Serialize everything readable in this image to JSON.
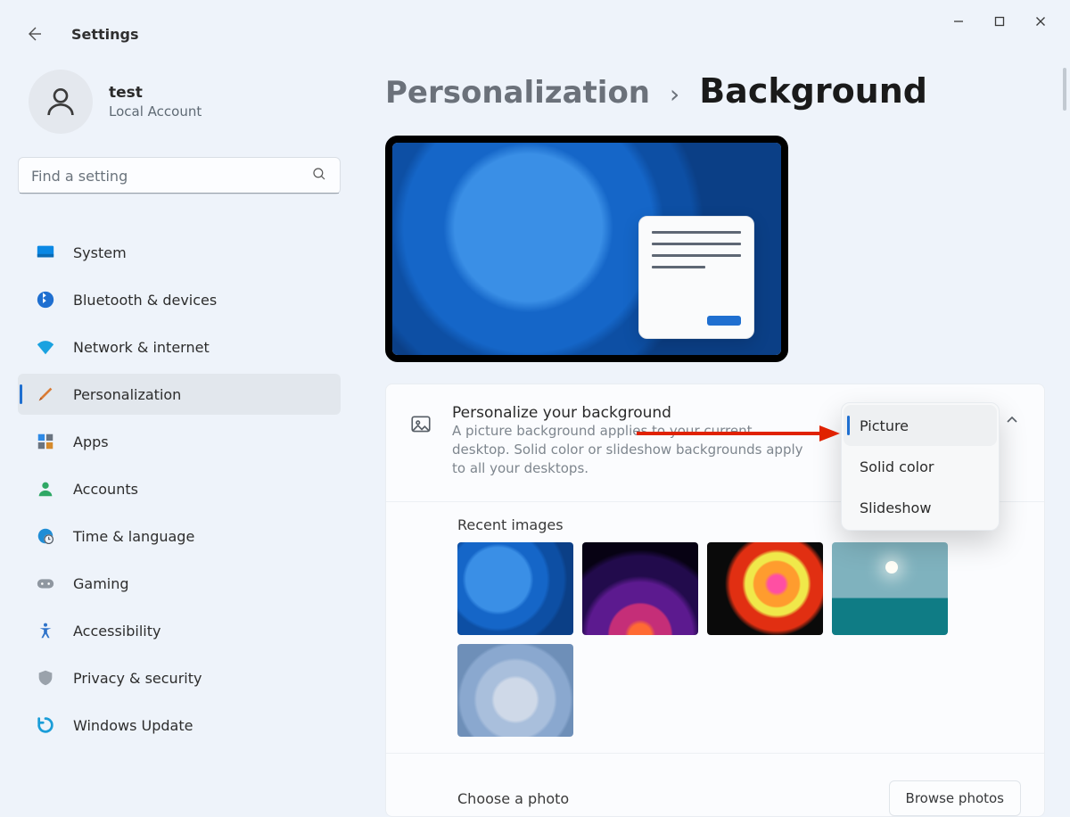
{
  "window": {
    "app_title": "Settings"
  },
  "profile": {
    "name": "test",
    "subtitle": "Local Account"
  },
  "search": {
    "placeholder": "Find a setting"
  },
  "nav": {
    "items": [
      {
        "label": "System",
        "icon": "system-icon"
      },
      {
        "label": "Bluetooth & devices",
        "icon": "bluetooth-icon"
      },
      {
        "label": "Network & internet",
        "icon": "wifi-icon"
      },
      {
        "label": "Personalization",
        "icon": "paintbrush-icon",
        "selected": true
      },
      {
        "label": "Apps",
        "icon": "apps-icon"
      },
      {
        "label": "Accounts",
        "icon": "account-icon"
      },
      {
        "label": "Time & language",
        "icon": "globe-clock-icon"
      },
      {
        "label": "Gaming",
        "icon": "gamepad-icon"
      },
      {
        "label": "Accessibility",
        "icon": "accessibility-icon"
      },
      {
        "label": "Privacy & security",
        "icon": "shield-icon"
      },
      {
        "label": "Windows Update",
        "icon": "update-icon"
      }
    ]
  },
  "breadcrumb": {
    "parent": "Personalization",
    "current": "Background"
  },
  "personalize_row": {
    "title": "Personalize your background",
    "description": "A picture background applies to your current desktop. Solid color or slideshow backgrounds apply to all your desktops.",
    "selected_value": "Picture",
    "options": [
      "Picture",
      "Solid color",
      "Slideshow"
    ]
  },
  "recent_images": {
    "title": "Recent images",
    "thumbs": [
      "bloom-blue",
      "sunset-orb",
      "ribbon",
      "lake",
      "silver-bloom"
    ]
  },
  "choose": {
    "label": "Choose a photo",
    "button": "Browse photos"
  },
  "colors": {
    "accent": "#1f6fd0"
  }
}
